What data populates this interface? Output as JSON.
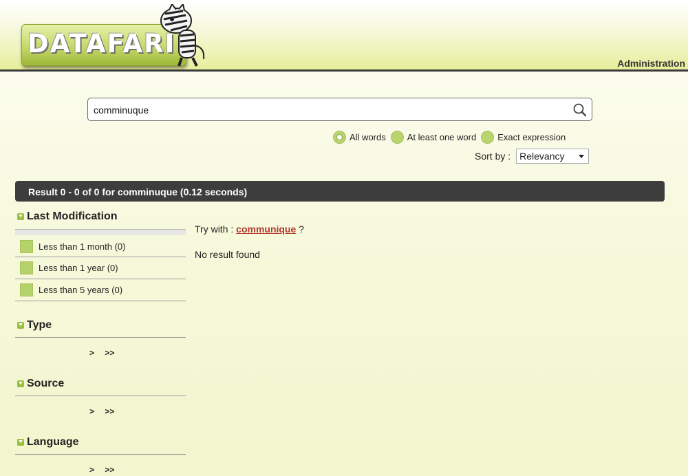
{
  "header": {
    "logo_text": "DATAFARI",
    "admin_link": "Administration"
  },
  "search": {
    "value": "comminuque",
    "button_icon": "search-icon"
  },
  "match_options": [
    {
      "label": "All words",
      "checked": true
    },
    {
      "label": "At least one word",
      "checked": false
    },
    {
      "label": "Exact expression",
      "checked": false
    }
  ],
  "sort": {
    "label": "Sort by :",
    "value": "Relevancy"
  },
  "results": {
    "summary": "Result 0 - 0 of 0 for comminuque (0.12 seconds)",
    "try_with_prefix": "Try with :",
    "suggestion": "communique",
    "try_with_suffix": "?",
    "no_result": "No result found"
  },
  "facets": {
    "last_modification": {
      "title": "Last Modification",
      "items": [
        {
          "label": "Less than 1 month (0)"
        },
        {
          "label": "Less than 1 year (0)"
        },
        {
          "label": "Less than 5 years (0)"
        }
      ]
    },
    "type": {
      "title": "Type",
      "next": ">",
      "last": ">>"
    },
    "source": {
      "title": "Source",
      "next": ">",
      "last": ">>"
    },
    "language": {
      "title": "Language",
      "next": ">",
      "last": ">>"
    }
  },
  "colors": {
    "accent_green": "#b5d16a",
    "header_bar": "#3d3d3d",
    "suggestion_red": "#b3372d"
  }
}
